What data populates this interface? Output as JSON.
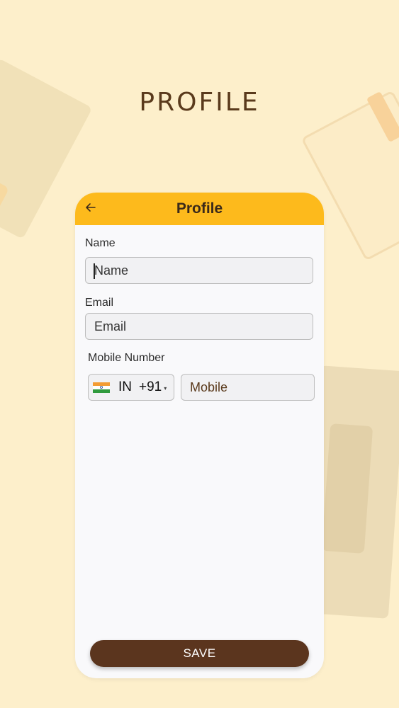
{
  "page": {
    "title": "PROFILE"
  },
  "app_bar": {
    "title": "Profile",
    "back_icon": "arrow-left-icon",
    "color": "#fdba1c"
  },
  "form": {
    "name": {
      "label": "Name",
      "placeholder": "Name",
      "value": ""
    },
    "email": {
      "label": "Email",
      "placeholder": "Email",
      "value": ""
    },
    "mobile": {
      "label": "Mobile Number",
      "country_flag": "india-flag-icon",
      "country_code": "IN",
      "dial_code": "+91",
      "placeholder": "Mobile",
      "value": ""
    }
  },
  "actions": {
    "save_label": "SAVE",
    "save_color": "#5b351e"
  },
  "colors": {
    "background": "#fdefcb",
    "accent": "#fdba1c",
    "brand_brown": "#5b351e"
  }
}
